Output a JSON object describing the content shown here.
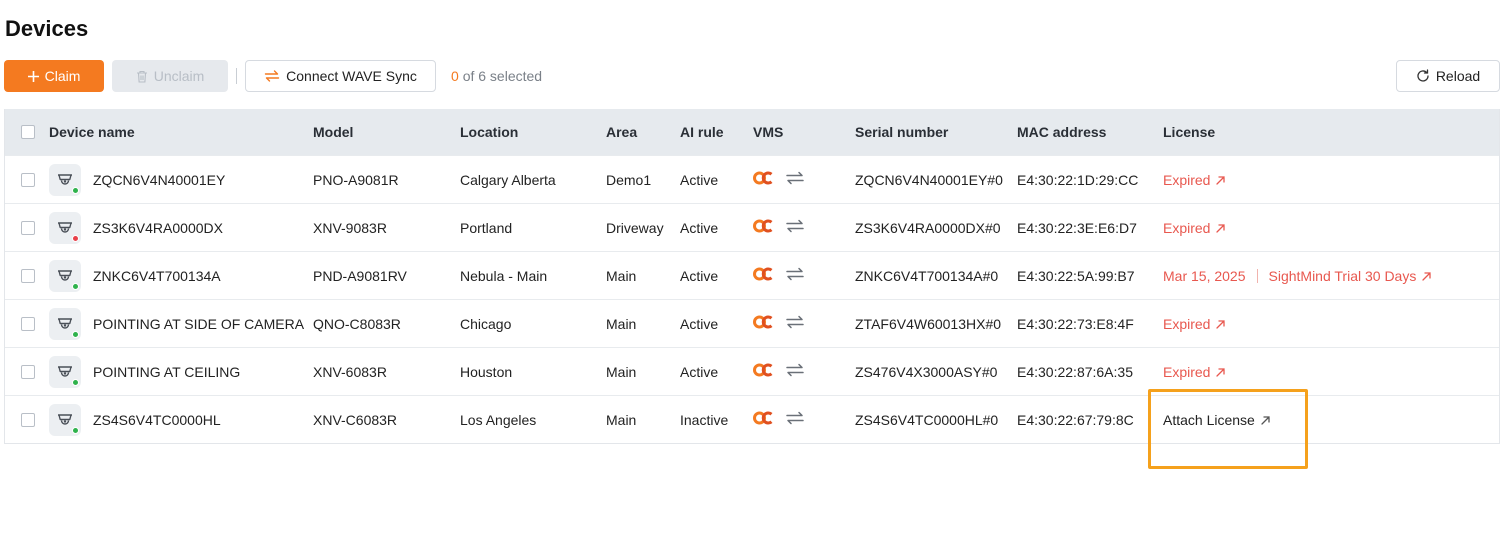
{
  "page": {
    "title": "Devices"
  },
  "toolbar": {
    "claim_label": "Claim",
    "unclaim_label": "Unclaim",
    "connect_label": "Connect WAVE Sync",
    "selected_count": "0",
    "selected_suffix": "of 6 selected",
    "reload_label": "Reload"
  },
  "table": {
    "headers": {
      "device_name": "Device name",
      "model": "Model",
      "location": "Location",
      "area": "Area",
      "ai_rule": "AI rule",
      "vms": "VMS",
      "serial": "Serial number",
      "mac": "MAC address",
      "license": "License"
    },
    "rows": [
      {
        "name": "ZQCN6V4N40001EY",
        "status_color": "#2fb24c",
        "model": "PNO-A9081R",
        "location": "Calgary Alberta",
        "area": "Demo1",
        "ai_rule": "Active",
        "serial": "ZQCN6V4N40001EY#0",
        "mac": "E4:30:22:1D:29:CC",
        "license": "Expired"
      },
      {
        "name": "ZS3K6V4RA0000DX",
        "status_color": "#e8404a",
        "model": "XNV-9083R",
        "location": "Portland",
        "area": "Driveway",
        "ai_rule": "Active",
        "serial": "ZS3K6V4RA0000DX#0",
        "mac": "E4:30:22:3E:E6:D7",
        "license": "Expired"
      },
      {
        "name": "ZNKC6V4T700134A",
        "status_color": "#2fb24c",
        "model": "PND-A9081RV",
        "location": "Nebula - Main",
        "area": "Main",
        "ai_rule": "Active",
        "serial": "ZNKC6V4T700134A#0",
        "mac": "E4:30:22:5A:99:B7",
        "license_date": "Mar 15, 2025",
        "license_plan": "SightMind Trial 30 Days"
      },
      {
        "name": "POINTING AT SIDE OF CAMERA",
        "status_color": "#2fb24c",
        "model": "QNO-C8083R",
        "location": "Chicago",
        "area": "Main",
        "ai_rule": "Active",
        "serial": "ZTAF6V4W60013HX#0",
        "mac": "E4:30:22:73:E8:4F",
        "license": "Expired"
      },
      {
        "name": "POINTING AT CEILING",
        "status_color": "#2fb24c",
        "model": "XNV-6083R",
        "location": "Houston",
        "area": "Main",
        "ai_rule": "Active",
        "serial": "ZS476V4X3000ASY#0",
        "mac": "E4:30:22:87:6A:35",
        "license": "Expired"
      },
      {
        "name": "ZS4S6V4TC0000HL",
        "status_color": "#2fb24c",
        "model": "XNV-C6083R",
        "location": "Los Angeles",
        "area": "Main",
        "ai_rule": "Inactive",
        "serial": "ZS4S6V4TC0000HL#0",
        "mac": "E4:30:22:67:79:8C",
        "license": "Attach License"
      }
    ]
  },
  "colors": {
    "accent": "#f47a20",
    "expired": "#e8584f",
    "online": "#2fb24c",
    "offline": "#e8404a",
    "highlight": "#f5a11c"
  },
  "icons": [
    "plus-icon",
    "trash-icon",
    "sync-icon",
    "reload-icon",
    "camera-icon",
    "vms-logo-icon",
    "external-link-icon"
  ]
}
